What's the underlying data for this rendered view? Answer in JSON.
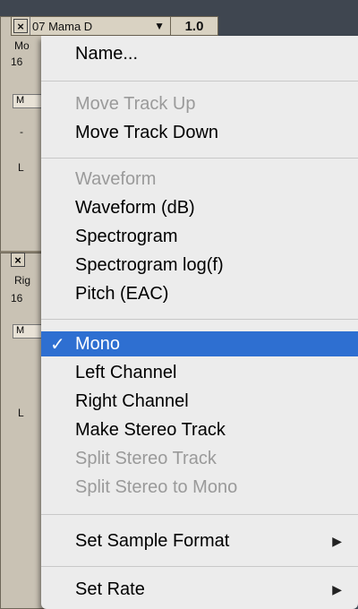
{
  "track1": {
    "name": "07 Mama D",
    "ruler_value": "1.0",
    "info_line1": "Mo",
    "info_line2": "16",
    "button_label": "M",
    "slider1": "-",
    "slider2": "L"
  },
  "track2": {
    "info_line1": "Rig",
    "info_line2": "16",
    "button_label": "M",
    "slider2": "L"
  },
  "menu": {
    "name": "Name...",
    "move_up": "Move Track Up",
    "move_down": "Move Track Down",
    "waveform": "Waveform",
    "waveform_db": "Waveform (dB)",
    "spectrogram": "Spectrogram",
    "spectrogram_log": "Spectrogram log(f)",
    "pitch": "Pitch (EAC)",
    "mono": "Mono",
    "mono_check": "✓",
    "left": "Left Channel",
    "right": "Right Channel",
    "make_stereo": "Make Stereo Track",
    "split_stereo": "Split Stereo Track",
    "split_stereo_mono": "Split Stereo to Mono",
    "sample_format": "Set Sample Format",
    "set_rate": "Set Rate",
    "submenu_glyph": "▶"
  }
}
